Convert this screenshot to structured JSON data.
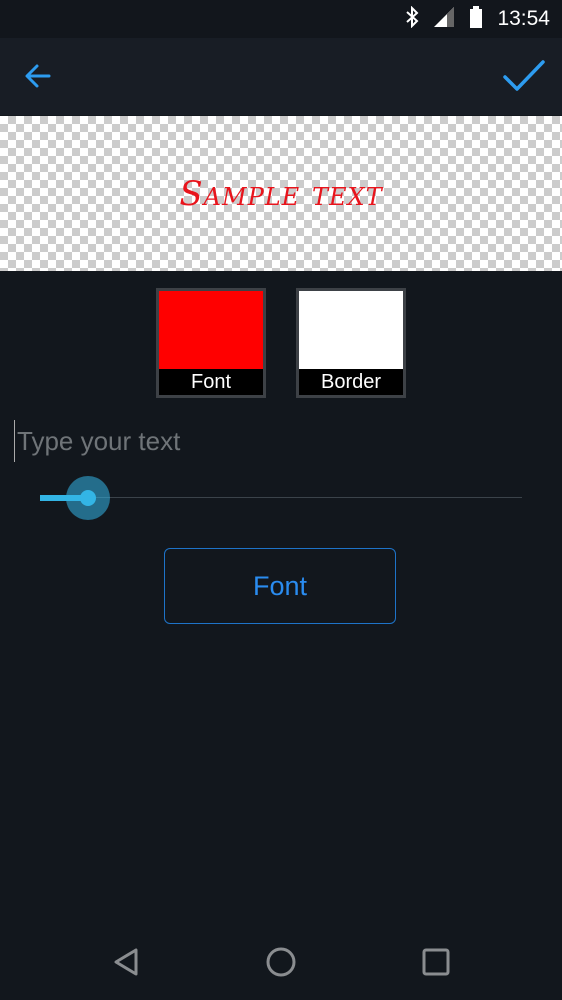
{
  "status_bar": {
    "time": "13:54",
    "icons": [
      "bluetooth-icon",
      "signal-icon",
      "battery-icon"
    ]
  },
  "toolbar": {
    "back_icon": "arrow-left-icon",
    "confirm_icon": "checkmark-icon",
    "accent_color": "#2d9cf0"
  },
  "preview": {
    "sample_text": "Sample text",
    "text_color": "#e8141c"
  },
  "swatches": [
    {
      "label": "Font",
      "color": "#ff0000"
    },
    {
      "label": "Border",
      "color": "#ffffff"
    }
  ],
  "text_input": {
    "value": "",
    "placeholder": "Type your text"
  },
  "size_slider": {
    "value_fraction": 0.1
  },
  "font_button": {
    "label": "Font"
  },
  "nav_bar": {
    "icons": [
      "back-triangle-icon",
      "home-circle-icon",
      "recents-square-icon"
    ]
  }
}
